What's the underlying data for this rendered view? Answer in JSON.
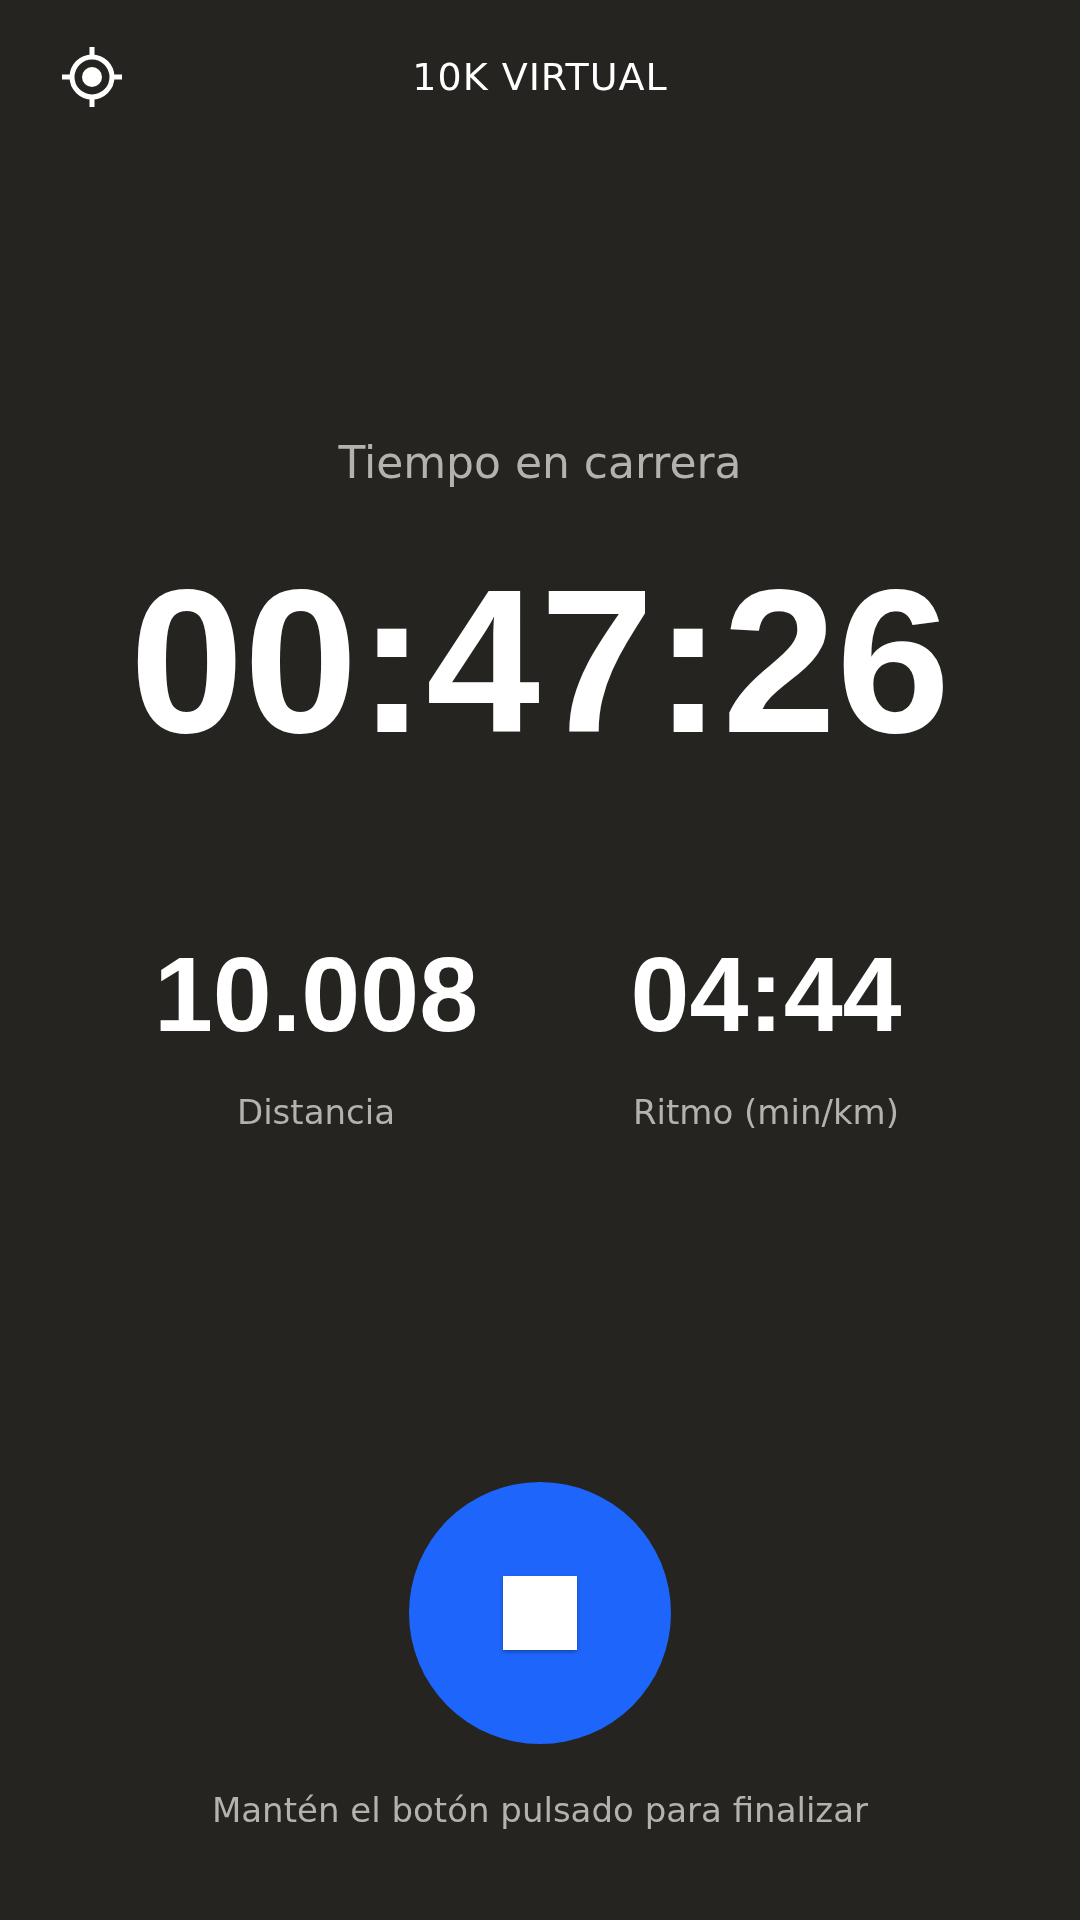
{
  "header": {
    "title": "10K VIRTUAL"
  },
  "timer": {
    "label": "Tiempo en carrera",
    "value": "00:47:26"
  },
  "stats": [
    {
      "value": "10.008",
      "label": "Distancia"
    },
    {
      "value": "04:44",
      "label": "Ritmo (min/km)"
    }
  ],
  "hint": "Mantén el botón pulsado para finalizar"
}
